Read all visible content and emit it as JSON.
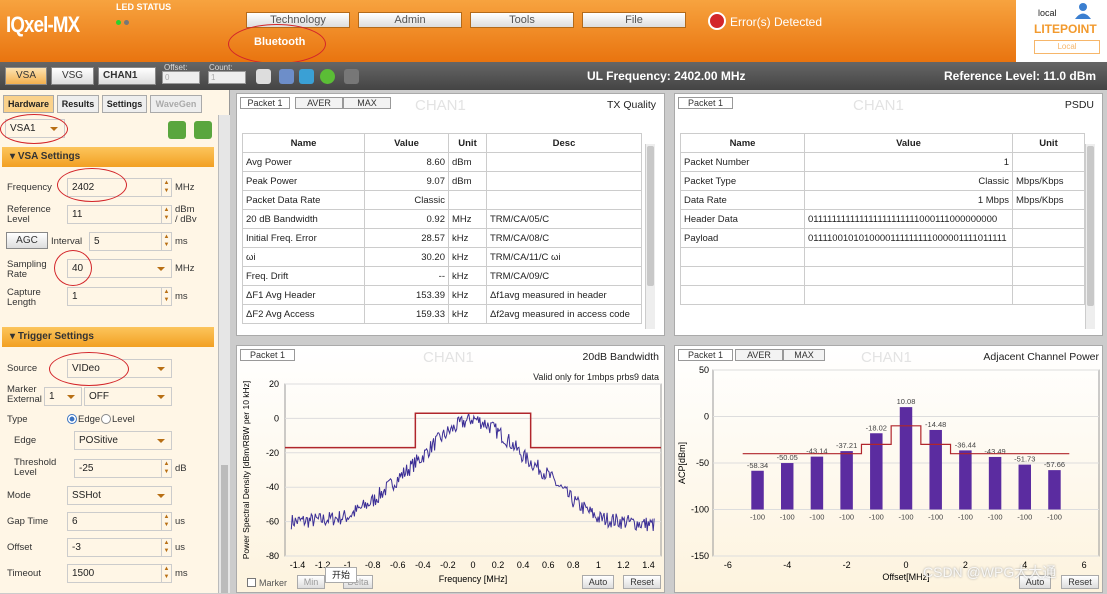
{
  "header": {
    "logo": "IQxel-MX",
    "led_status": "LED STATUS",
    "menu": [
      "Technology",
      "Admin",
      "Tools",
      "File"
    ],
    "bluetooth": "Bluetooth",
    "error": "Error(s) Detected",
    "user": "local",
    "brand": "LITEPOINT",
    "brand_sub": "Local",
    "colors": {
      "orange": "#ef8a1f",
      "error": "#d3252a"
    }
  },
  "toolbar": {
    "vsa": "VSA",
    "vsg": "VSG",
    "chan": "CHAN1",
    "offset_label": "Offset:",
    "offset_value": "0",
    "count_label": "Count:",
    "count_value": "1",
    "ul_freq": "UL Frequency: 2402.00 MHz",
    "ref_level": "Reference Level: 11.0 dBm"
  },
  "left": {
    "tabs": [
      "Hardware",
      "Results",
      "Settings",
      "WaveGen"
    ],
    "device": "VSA1",
    "vsa_settings": "VSA Settings",
    "frequency_label": "Frequency",
    "frequency": "2402",
    "frequency_unit": "MHz",
    "ref_label": "Reference Level",
    "ref": "11",
    "ref_unit": "dBm / dBv",
    "agc": "AGC",
    "interval_label": "Interval",
    "interval": "5",
    "interval_unit": "ms",
    "sampling_label": "Sampling Rate",
    "sampling": "40",
    "sampling_unit": "MHz",
    "capture_label": "Capture Length",
    "capture": "1",
    "capture_unit": "ms",
    "trigger_settings": "Trigger Settings",
    "source_label": "Source",
    "source": "VIDeo",
    "marker_label": "Marker External",
    "marker_num": "1",
    "marker_val": "OFF",
    "type_label": "Type",
    "edge_opt": "Edge",
    "level_opt": "Level",
    "edge_label": "Edge",
    "edge": "POSitive",
    "threshold_label": "Threshold Level",
    "threshold": "-25",
    "threshold_unit": "dB",
    "mode_label": "Mode",
    "mode": "SSHot",
    "gap_label": "Gap Time",
    "gap": "6",
    "gap_unit": "us",
    "offset_label": "Offset",
    "offset": "-3",
    "offset_unit": "us",
    "timeout_label": "Timeout",
    "timeout": "1500",
    "timeout_unit": "ms"
  },
  "txq": {
    "tabs": [
      "Packet 1",
      "AVER",
      "MAX"
    ],
    "chan": "CHAN1",
    "title": "TX Quality",
    "headers": [
      "Name",
      "Value",
      "Unit",
      "Desc"
    ],
    "rows": [
      [
        "Avg Power",
        "8.60",
        "dBm",
        ""
      ],
      [
        "Peak Power",
        "9.07",
        "dBm",
        ""
      ],
      [
        "Packet Data Rate",
        "Classic",
        "",
        ""
      ],
      [
        "20 dB Bandwidth",
        "0.92",
        "MHz",
        "TRM/CA/05/C"
      ],
      [
        "Initial Freq. Error",
        "28.57",
        "kHz",
        "TRM/CA/08/C"
      ],
      [
        "ωi",
        "30.20",
        "kHz",
        "TRM/CA/11/C ωi"
      ],
      [
        "Freq. Drift",
        "--",
        "kHz",
        "TRM/CA/09/C"
      ],
      [
        "ΔF1 Avg Header",
        "153.39",
        "kHz",
        "Δf1avg measured in header"
      ],
      [
        "ΔF2 Avg Access",
        "159.33",
        "kHz",
        "Δf2avg measured in access code"
      ]
    ]
  },
  "psdu": {
    "tabs": [
      "Packet 1"
    ],
    "chan": "CHAN1",
    "title": "PSDU",
    "headers": [
      "Name",
      "Value",
      "Unit"
    ],
    "rows": [
      [
        "Packet Number",
        "1",
        ""
      ],
      [
        "Packet Type",
        "Classic",
        "Mbps/Kbps"
      ],
      [
        "Data Rate",
        "1 Mbps",
        "Mbps/Kbps"
      ],
      [
        "Header Data",
        "011111111111111111111111000111000000000",
        ""
      ],
      [
        "Payload",
        "0111100101010000111111111000001111011111",
        ""
      ],
      [
        "",
        "",
        ""
      ],
      [
        "",
        "",
        ""
      ],
      [
        "",
        "",
        ""
      ]
    ]
  },
  "bw": {
    "tabs": [
      "Packet 1"
    ],
    "chan": "CHAN1",
    "title": "20dB Bandwidth",
    "note": "Valid only for 1mbps prbs9 data",
    "marker": "Marker",
    "min": "Min",
    "delta": "Delta",
    "auto": "Auto",
    "reset": "Reset",
    "ime": "开始"
  },
  "acp": {
    "tabs": [
      "Packet 1",
      "AVER",
      "MAX"
    ],
    "chan": "CHAN1",
    "title": "Adjacent Channel Power",
    "auto": "Auto",
    "reset": "Reset",
    "watermark": "CSDN @WPG大大通"
  },
  "chart_data": [
    {
      "type": "line",
      "title": "20dB Bandwidth",
      "xlabel": "Frequency [MHz]",
      "ylabel": "Power Spectral Density [dBm/RBW per 10 kHz]",
      "xlim": [
        -1.5,
        1.5
      ],
      "ylim": [
        -80,
        20
      ],
      "xticks": [
        "-1.4",
        "-1.2",
        "-1",
        "-0.8",
        "-0.6",
        "-0.4",
        "-0.2",
        "0",
        "0.2",
        "0.4",
        "0.6",
        "0.8",
        "1",
        "1.2",
        "1.4"
      ],
      "yticks": [
        "20",
        "0",
        "-20",
        "-40",
        "-60",
        "-80"
      ],
      "mask": {
        "x": [
          -1.5,
          -0.46,
          -0.46,
          0.46,
          0.46,
          1.5
        ],
        "y": [
          -17,
          -17,
          3,
          3,
          -17,
          -17
        ]
      },
      "spectrum": {
        "x": [
          -1.45,
          -1.2,
          -1.0,
          -0.8,
          -0.6,
          -0.4,
          -0.3,
          -0.2,
          -0.1,
          0,
          0.1,
          0.2,
          0.3,
          0.4,
          0.6,
          0.8,
          1.0,
          1.2,
          1.45
        ],
        "y": [
          -60,
          -59,
          -57,
          -48,
          -35,
          -22,
          -14,
          -8,
          -3,
          0,
          -3,
          -8,
          -14,
          -22,
          -33,
          -48,
          -58,
          -60,
          -62
        ]
      }
    },
    {
      "type": "bar",
      "title": "Adjacent Channel Power",
      "xlabel": "Offset[MHz]",
      "ylabel": "ACP[dBm]",
      "xlim": [
        -6.5,
        6.5
      ],
      "ylim": [
        -150,
        50
      ],
      "xticks": [
        "-6",
        "-4",
        "-2",
        "0",
        "2",
        "4",
        "6"
      ],
      "yticks": [
        "50",
        "0",
        "-50",
        "-100",
        "-150"
      ],
      "x": [
        -5,
        -4,
        -3,
        -2,
        -1,
        0,
        1,
        2,
        3,
        4,
        5
      ],
      "values": [
        -58.34,
        -50.05,
        -43.14,
        -37.21,
        -18.02,
        10.08,
        -14.48,
        -36.44,
        -43.49,
        -51.73,
        -57.66
      ],
      "value_labels": [
        "-58.34",
        "-50.05",
        "-43.14",
        "-37.21",
        "-18.02",
        "10.08",
        "-14.48",
        "-36.44",
        "-43.49",
        "-51.73",
        "-57.66"
      ],
      "limit": {
        "x": [
          -5.5,
          -1.5,
          -1.5,
          -0.5,
          -0.5,
          0.5,
          0.5,
          1.5,
          1.5,
          5.5
        ],
        "y": [
          -40,
          -40,
          -30,
          -30,
          -10,
          -10,
          -30,
          -30,
          -40,
          -40
        ]
      },
      "baseline": -100,
      "baseline_label": "-100"
    }
  ]
}
